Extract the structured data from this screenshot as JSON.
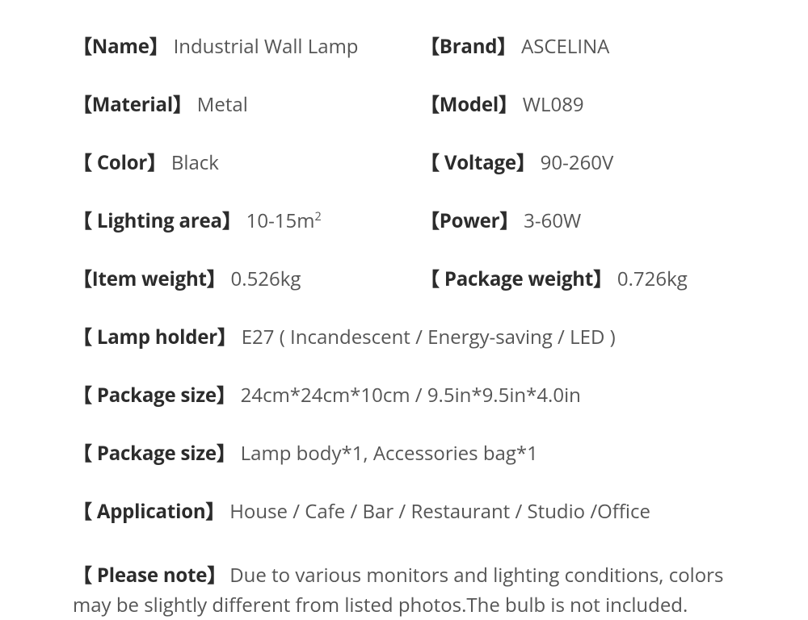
{
  "specs": {
    "name": {
      "label": "【Name】",
      "value": "Industrial Wall Lamp"
    },
    "brand": {
      "label": "【Brand】",
      "value": "ASCELINA"
    },
    "material": {
      "label": "【Material】",
      "value": "Metal"
    },
    "model": {
      "label": "【Model】",
      "value": "WL089"
    },
    "color": {
      "label": "【 Color】",
      "value": "Black"
    },
    "voltage": {
      "label": "【 Voltage】",
      "value": "90-260V"
    },
    "lighting": {
      "label": "【 Lighting area】",
      "value": "10-15m",
      "super": "2"
    },
    "power": {
      "label": "【Power】",
      "value": "3-60W"
    },
    "itemwt": {
      "label": "【Item weight】",
      "value": "0.526kg"
    },
    "pkgwt": {
      "label": "【 Package weight】",
      "value": "0.726kg"
    },
    "holder": {
      "label": "【 Lamp holder】",
      "value": "E27 ( Incandescent / Energy-saving / LED )"
    },
    "pkgsize": {
      "label": "【 Package size】",
      "value": "24cm*24cm*10cm / 9.5in*9.5in*4.0in"
    },
    "pkgcontent": {
      "label": "【 Package size】",
      "value": "Lamp body*1, Accessories bag*1"
    },
    "application": {
      "label": "【 Application】",
      "value": "House / Cafe / Bar / Restaurant / Studio /Office"
    },
    "note": {
      "label": "【 Please note】",
      "value": "Due to various monitors and lighting conditions, colors may be slightly different from listed photos.The bulb is not included."
    }
  }
}
